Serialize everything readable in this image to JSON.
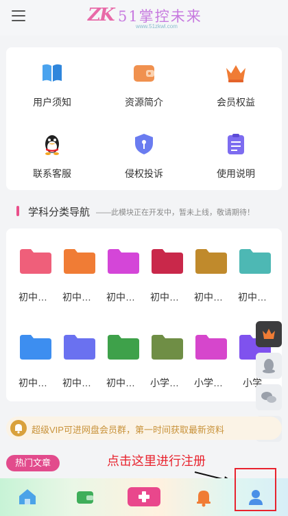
{
  "header": {
    "logo_mark": "ZK",
    "logo_text": "51掌控未来",
    "logo_url": "www.51zkwl.com"
  },
  "features": [
    {
      "label": "用户须知",
      "icon": "book-icon"
    },
    {
      "label": "资源简介",
      "icon": "wallet-icon"
    },
    {
      "label": "会员权益",
      "icon": "crown-icon"
    },
    {
      "label": "联系客服",
      "icon": "qq-penguin-icon"
    },
    {
      "label": "侵权投诉",
      "icon": "shield-icon"
    },
    {
      "label": "使用说明",
      "icon": "clipboard-icon"
    }
  ],
  "section": {
    "title": "学科分类导航",
    "subtitle": "——此模块正在开发中，暂未上线，敬请期待！"
  },
  "folders": [
    {
      "label": "初中…",
      "color": "#ef5f7a"
    },
    {
      "label": "初中…",
      "color": "#f07c35"
    },
    {
      "label": "初中…",
      "color": "#d446d8"
    },
    {
      "label": "初中…",
      "color": "#c9284a"
    },
    {
      "label": "初中…",
      "color": "#c08a2c"
    },
    {
      "label": "初中…",
      "color": "#4db8b4"
    },
    {
      "label": "初中…",
      "color": "#3d8ef0"
    },
    {
      "label": "初中…",
      "color": "#6a71f0"
    },
    {
      "label": "初中…",
      "color": "#3ea14a"
    },
    {
      "label": "小学…",
      "color": "#6f8e45"
    },
    {
      "label": "小学…",
      "color": "#d646cc"
    },
    {
      "label": "小学",
      "color": "#7f52ee"
    }
  ],
  "notice": {
    "text": "超级VIP可进网盘会员群，第一时间获取最新资料"
  },
  "hot_tag": "热门文章",
  "register_hint": "点击这里进行注册",
  "tabs": [
    {
      "name": "home"
    },
    {
      "name": "wallet"
    },
    {
      "name": "publish"
    },
    {
      "name": "notifications"
    },
    {
      "name": "profile"
    }
  ],
  "colors": {
    "accent_pink": "#e24b8c",
    "hint_red": "#e8222d",
    "notice_gold": "#c8923a"
  }
}
